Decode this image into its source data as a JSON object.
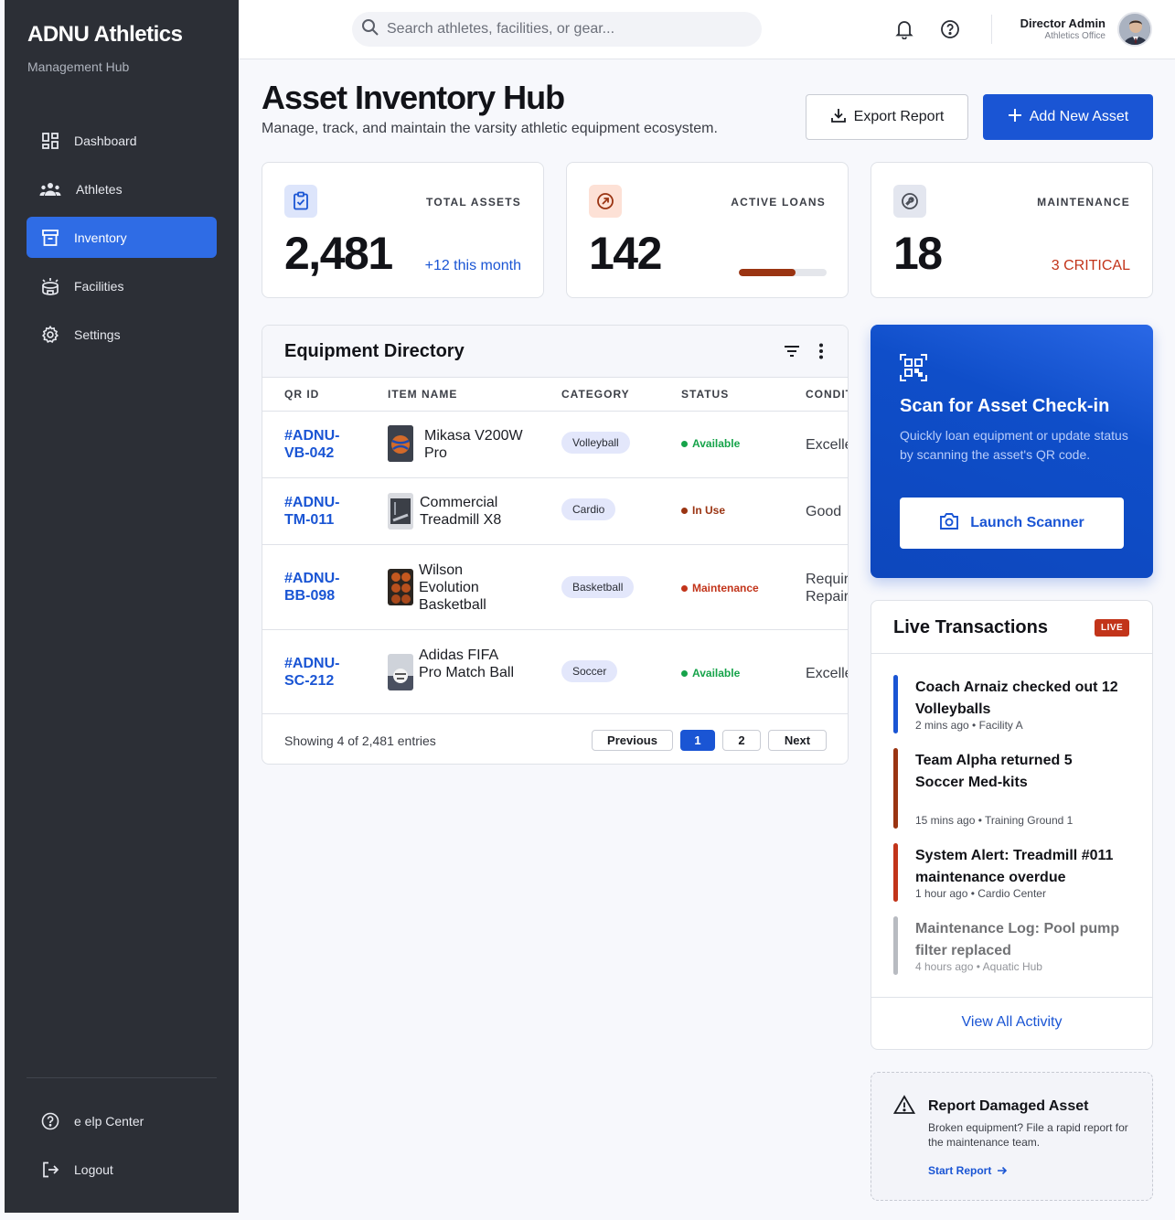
{
  "sidebar": {
    "brand": "ADNU Athletics",
    "brand_sub": "Management Hub",
    "items": [
      {
        "label": "Dashboard",
        "icon": "dashboard-icon"
      },
      {
        "label": "Athletes",
        "icon": "group-icon"
      },
      {
        "label": "Inventory",
        "icon": "inventory-icon",
        "active": true
      },
      {
        "label": "Facilities",
        "icon": "stadium-icon"
      },
      {
        "label": "Settings",
        "icon": "gear-icon"
      }
    ],
    "help_label": "e elp Center",
    "logout_label": "Logout"
  },
  "topbar": {
    "search_placeholder": "Search athletes, facilities, or gear...",
    "user_name": "Director Admin",
    "user_role": "Athletics Office"
  },
  "header": {
    "title": "Asset Inventory Hub",
    "subtitle": "Manage, track, and maintain the varsity athletic equipment ecosystem.",
    "export_label": "Export Report",
    "add_label": "Add New Asset"
  },
  "stats": {
    "total": {
      "label": "TOTAL ASSETS",
      "value": "2,481",
      "note": "+12 this month"
    },
    "loans": {
      "label": "ACTIVE LOANS",
      "value": "142",
      "progress": 0.65
    },
    "maintenance": {
      "label": "MAINTENANCE",
      "value": "18",
      "note": "3 CRITICAL"
    }
  },
  "directory": {
    "title": "Equipment Directory",
    "columns": [
      "QR ID",
      "ITEM NAME",
      "CATEGORY",
      "STATUS",
      "CONDIT"
    ],
    "rows": [
      {
        "qr": "#ADNU-VB-042",
        "name": "Mikasa V200W Pro",
        "category": "Volleyball",
        "status": "Available",
        "condition": "Excelle"
      },
      {
        "qr": "#ADNU-TM-011",
        "name": "Commercial Treadmill X8",
        "category": "Cardio",
        "status": "In Use",
        "condition": "Good"
      },
      {
        "qr": "#ADNU-BB-098",
        "name": "Wilson Evolution Basketball",
        "category": "Basketball",
        "status": "Maintenance",
        "condition": "Requir Repair"
      },
      {
        "qr": "#ADNU-SC-212",
        "name": "Adidas FIFA Pro Match Ball",
        "category": "Soccer",
        "status": "Available",
        "condition": "Excelle"
      }
    ],
    "footer": "Showing 4 of 2,481 entries",
    "pagination": {
      "previous": "Previous",
      "pages": [
        "1",
        "2"
      ],
      "next": "Next"
    }
  },
  "scan": {
    "title": "Scan for Asset Check-in",
    "description": "Quickly loan equipment or update status by scanning the asset's QR code.",
    "button": "Launch Scanner"
  },
  "live": {
    "title": "Live Transactions",
    "badge": "LIVE",
    "items": [
      {
        "title": "Coach Arnaiz checked out 12 Volleyballs",
        "meta": "2 mins ago • Facility A",
        "color": "#1a55d4"
      },
      {
        "title": "Team Alpha returned 5 Soccer Med-kits",
        "meta": "15 mins ago • Training Ground 1",
        "color": "#9a3412"
      },
      {
        "title": "System Alert: Treadmill #011 maintenance overdue",
        "meta": "1 hour ago • Cardio Center",
        "color": "#c2341a"
      },
      {
        "title": "Maintenance Log: Pool pump filter replaced",
        "meta": "4 hours ago • Aquatic Hub",
        "color": "#b6b9c2"
      }
    ],
    "view_all": "View All Activity"
  },
  "report": {
    "title": "Report Damaged Asset",
    "description": "Broken equipment? File a rapid report for the maintenance team.",
    "link": "Start Report"
  },
  "colors": {
    "accent": "#1a55d4",
    "sidebar_bg": "#2c2f36",
    "available": "#16a34a",
    "in_use": "#9a3412",
    "maintenance": "#c2341a"
  }
}
